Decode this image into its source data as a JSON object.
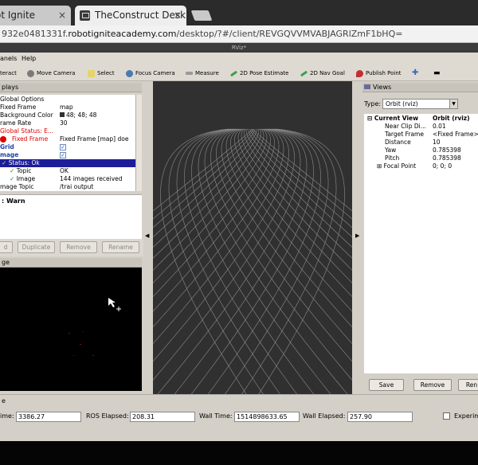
{
  "browser": {
    "tabs": [
      {
        "label": "ot Ignite"
      },
      {
        "label": "TheConstruct Desk"
      }
    ],
    "tab_close": "×",
    "url_prefix": "932e0481331f.",
    "url_domain": "robotigniteacademy.com",
    "url_suffix": "/desktop/?#/client/REVGQVVMVABJAGRlZmF1bHQ="
  },
  "rviz": {
    "window_title": "RViz*",
    "menu": [
      "anels",
      "Help"
    ],
    "toolbar": [
      "teract",
      "Move Camera",
      "Select",
      "Focus Camera",
      "Measure",
      "2D Pose Estimate",
      "2D Nav Goal",
      "Publish Point"
    ],
    "toolbar_colors": {
      "move": "#7a7a7a",
      "select": "#e6d36a",
      "focus": "#4a7ab0",
      "measure": "#9a9a9a",
      "pose": "#3aa04a",
      "nav": "#3aa04a",
      "publish": "#c03030",
      "plus": "#3a6ac0"
    },
    "displays": {
      "header": "plays",
      "rows": [
        {
          "k": "Global Options",
          "v": "",
          "style": ""
        },
        {
          "k": "Fixed Frame",
          "v": "map",
          "style": ""
        },
        {
          "k": "Background Color",
          "v": "48; 48; 48",
          "style": "swatch"
        },
        {
          "k": "rame Rate",
          "v": "30",
          "style": ""
        },
        {
          "k": "Global Status: E...",
          "v": "",
          "style": "err"
        },
        {
          "k": "Fixed Frame",
          "v": "Fixed Frame [map] doe",
          "style": "errdot"
        },
        {
          "k": "Grid",
          "v": "✓",
          "style": "blue"
        },
        {
          "k": "mage",
          "v": "✓",
          "style": "blue"
        },
        {
          "k": "Status: Ok",
          "v": "",
          "style": "sel"
        },
        {
          "k": "Topic",
          "v": "OK",
          "style": "tick"
        },
        {
          "k": "Image",
          "v": "144 images received",
          "style": "tick"
        },
        {
          "k": "mage Topic",
          "v": "/trai  output",
          "style": ""
        }
      ],
      "description": ": Warn",
      "buttons": [
        "d",
        "Duplicate",
        "Remove",
        "Rename"
      ]
    },
    "image_panel": {
      "header": "ge"
    },
    "views": {
      "header": "Views",
      "type_label": "Type:",
      "type_value": "Orbit (rviz)",
      "rows": [
        {
          "k": "Current View",
          "v": "Orbit (rviz)",
          "bold": true,
          "indent": 4
        },
        {
          "k": "Near Clip Di...",
          "v": "0.01",
          "indent": 26
        },
        {
          "k": "Target Frame",
          "v": "<Fixed Frame>",
          "indent": 26
        },
        {
          "k": "Distance",
          "v": "10",
          "indent": 26
        },
        {
          "k": "Yaw",
          "v": "0.785398",
          "indent": 26
        },
        {
          "k": "Pitch",
          "v": "0.785398",
          "indent": 26
        },
        {
          "k": "Focal Point",
          "v": "0; 0; 0",
          "indent": 16
        }
      ],
      "buttons": [
        "Save",
        "Remove",
        "Ren"
      ]
    },
    "time": {
      "header": "e",
      "ros_time_label": "ime:",
      "ros_time": "3386.27",
      "ros_elapsed_label": "ROS Elapsed:",
      "ros_elapsed": "208.31",
      "wall_time_label": "Wall Time:",
      "wall_time": "1514898633.65",
      "wall_elapsed_label": "Wall Elapsed:",
      "wall_elapsed": "257.90",
      "experimental_label": "Experim"
    }
  }
}
